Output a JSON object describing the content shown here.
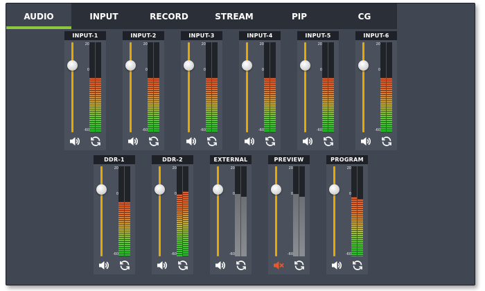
{
  "tabs": [
    {
      "label": "AUDIO",
      "active": true
    },
    {
      "label": "INPUT",
      "active": false
    },
    {
      "label": "RECORD",
      "active": false
    },
    {
      "label": "STREAM",
      "active": false
    },
    {
      "label": "PIP",
      "active": false
    },
    {
      "label": "CG",
      "active": false
    }
  ],
  "scale_labels": {
    "top": "20",
    "zero": "0",
    "bottom": "-60"
  },
  "colors": {
    "accent": "#8dc63f",
    "fader_track": "#e9a800",
    "mute_icon": "#e8562a"
  },
  "channels": [
    {
      "id": "input-1",
      "label": "INPUT-1",
      "fader_level": 0.75,
      "meter": [
        0.61,
        0.61
      ],
      "meter_style": "color",
      "muted": false
    },
    {
      "id": "input-2",
      "label": "INPUT-2",
      "fader_level": 0.75,
      "meter": [
        0.61,
        0.61
      ],
      "meter_style": "color",
      "muted": false
    },
    {
      "id": "input-3",
      "label": "INPUT-3",
      "fader_level": 0.75,
      "meter": [
        0.61,
        0.61
      ],
      "meter_style": "color",
      "muted": false
    },
    {
      "id": "input-4",
      "label": "INPUT-4",
      "fader_level": 0.75,
      "meter": [
        0.61,
        0.61
      ],
      "meter_style": "color",
      "muted": false
    },
    {
      "id": "input-5",
      "label": "INPUT-5",
      "fader_level": 0.75,
      "meter": [
        0.61,
        0.61
      ],
      "meter_style": "color",
      "muted": false
    },
    {
      "id": "input-6",
      "label": "INPUT-6",
      "fader_level": 0.75,
      "meter": [
        0.61,
        0.61
      ],
      "meter_style": "color",
      "muted": false
    },
    {
      "id": "ddr-1",
      "label": "DDR-1",
      "fader_level": 0.75,
      "meter": [
        0.61,
        0.61
      ],
      "meter_style": "color",
      "muted": false
    },
    {
      "id": "ddr-2",
      "label": "DDR-2",
      "fader_level": 0.75,
      "meter": [
        0.69,
        0.72
      ],
      "meter_style": "color",
      "muted": false
    },
    {
      "id": "external",
      "label": "EXTERNAL",
      "fader_level": 0.75,
      "meter": [
        0.69,
        0.66
      ],
      "meter_style": "gray",
      "muted": false
    },
    {
      "id": "preview",
      "label": "PREVIEW",
      "fader_level": 0.75,
      "meter": [
        0.69,
        0.66
      ],
      "meter_style": "gray",
      "muted": true
    },
    {
      "id": "program",
      "label": "PROGRAM",
      "fader_level": 0.75,
      "meter": [
        0.66,
        0.64
      ],
      "meter_style": "color",
      "muted": false
    }
  ]
}
